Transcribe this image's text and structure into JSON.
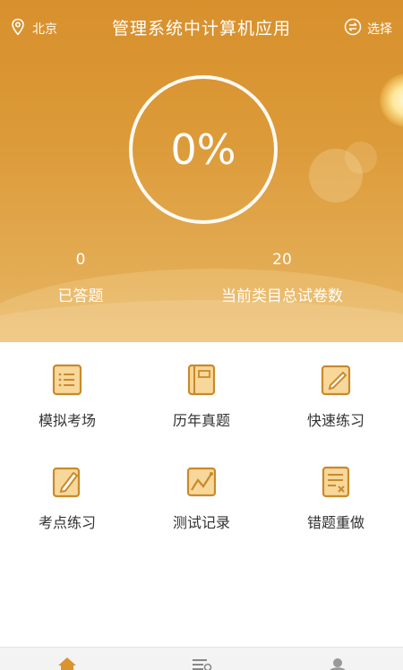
{
  "header": {
    "location": "北京",
    "title": "管理系统中计算机应用",
    "select_label": "选择"
  },
  "progress": {
    "percent_text": "0%",
    "answered_count": "0",
    "answered_label": "已答题",
    "total_count": "20",
    "total_label": "当前类目总试卷数"
  },
  "menu": [
    {
      "label": "模拟考场",
      "icon": "list-doc-icon"
    },
    {
      "label": "历年真题",
      "icon": "book-icon"
    },
    {
      "label": "快速练习",
      "icon": "edit-icon"
    },
    {
      "label": "考点练习",
      "icon": "note-pen-icon"
    },
    {
      "label": "测试记录",
      "icon": "chart-icon"
    },
    {
      "label": "错题重做",
      "icon": "doc-x-icon"
    }
  ],
  "tabs": [
    {
      "icon": "home-icon"
    },
    {
      "icon": "list-icon"
    },
    {
      "icon": "user-icon"
    }
  ],
  "colors": {
    "accent": "#d9932f",
    "icon_fill": "#f7d79a",
    "text": "#333333"
  }
}
